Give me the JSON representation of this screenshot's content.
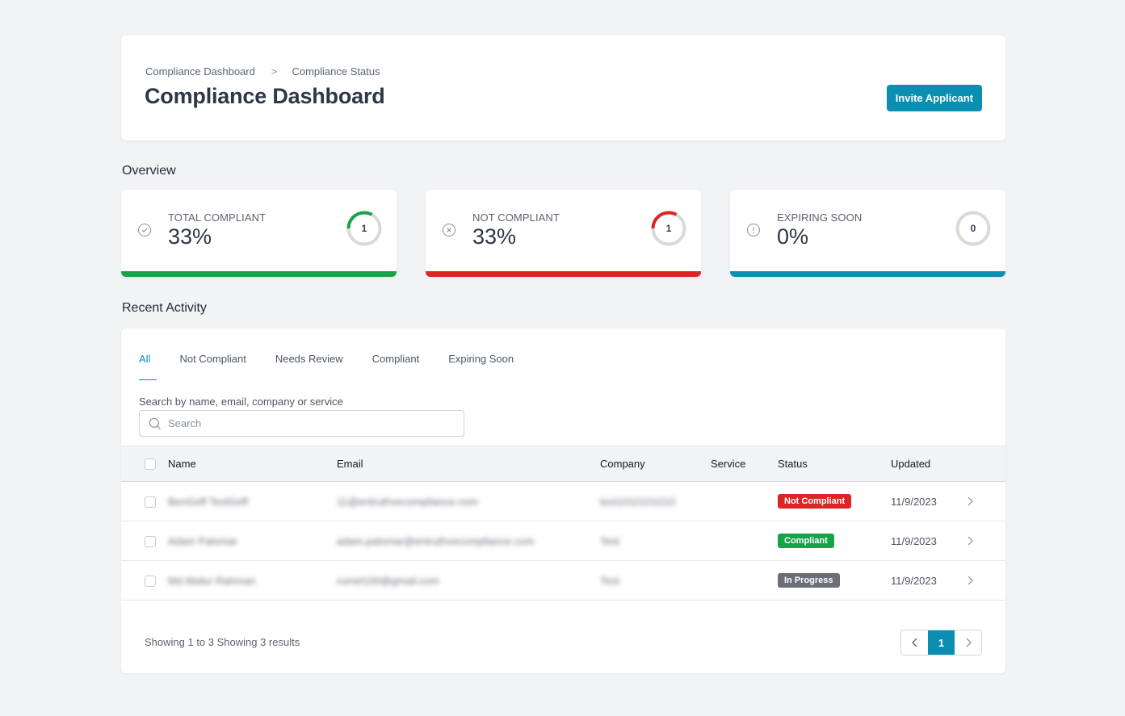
{
  "header": {
    "breadcrumb": [
      "Compliance Dashboard",
      "Compliance Status"
    ],
    "title": "Compliance Dashboard",
    "invite_label": "Invite Applicant"
  },
  "overview": {
    "title": "Overview",
    "cards": [
      {
        "label": "TOTAL COMPLIANT",
        "value": "33%",
        "count": "1",
        "fraction": 0.33,
        "icon": "check-circle-icon",
        "color": "#16a34a"
      },
      {
        "label": "NOT COMPLIANT",
        "value": "33%",
        "count": "1",
        "fraction": 0.33,
        "icon": "x-circle-icon",
        "color": "#dc2626"
      },
      {
        "label": "EXPIRING SOON",
        "value": "0%",
        "count": "0",
        "fraction": 0,
        "icon": "alert-circle-icon",
        "color": "#0a8fb3"
      }
    ]
  },
  "activity": {
    "title": "Recent Activity",
    "tabs": [
      "All",
      "Not Compliant",
      "Needs Review",
      "Compliant",
      "Expiring Soon"
    ],
    "active_tab": "All",
    "search_label": "Search by name, email, company or service",
    "search_placeholder": "Search",
    "search_value": "",
    "columns": [
      "Name",
      "Email",
      "Company",
      "Service",
      "Status",
      "Updated"
    ],
    "rows": [
      {
        "name": "BenGeff TestGeff",
        "email": "11@entruthvecompliance.com",
        "company": "test1010101010",
        "service": "",
        "status": "Not Compliant",
        "status_color": "#dc2626",
        "updated": "11/9/2023"
      },
      {
        "name": "Adam Palomar",
        "email": "adam.palomar@entruthvecompliance.com",
        "company": "Test",
        "service": "",
        "status": "Compliant",
        "status_color": "#16a34a",
        "updated": "11/9/2023"
      },
      {
        "name": "Md Abdur Rahman",
        "email": "rumel100@gmail.com",
        "company": "Test",
        "service": "",
        "status": "In Progress",
        "status_color": "#6b6e76",
        "updated": "11/9/2023"
      }
    ],
    "footer_text": "Showing 1 to 3 Showing 3 results",
    "pagination": {
      "current_page": "1"
    }
  }
}
